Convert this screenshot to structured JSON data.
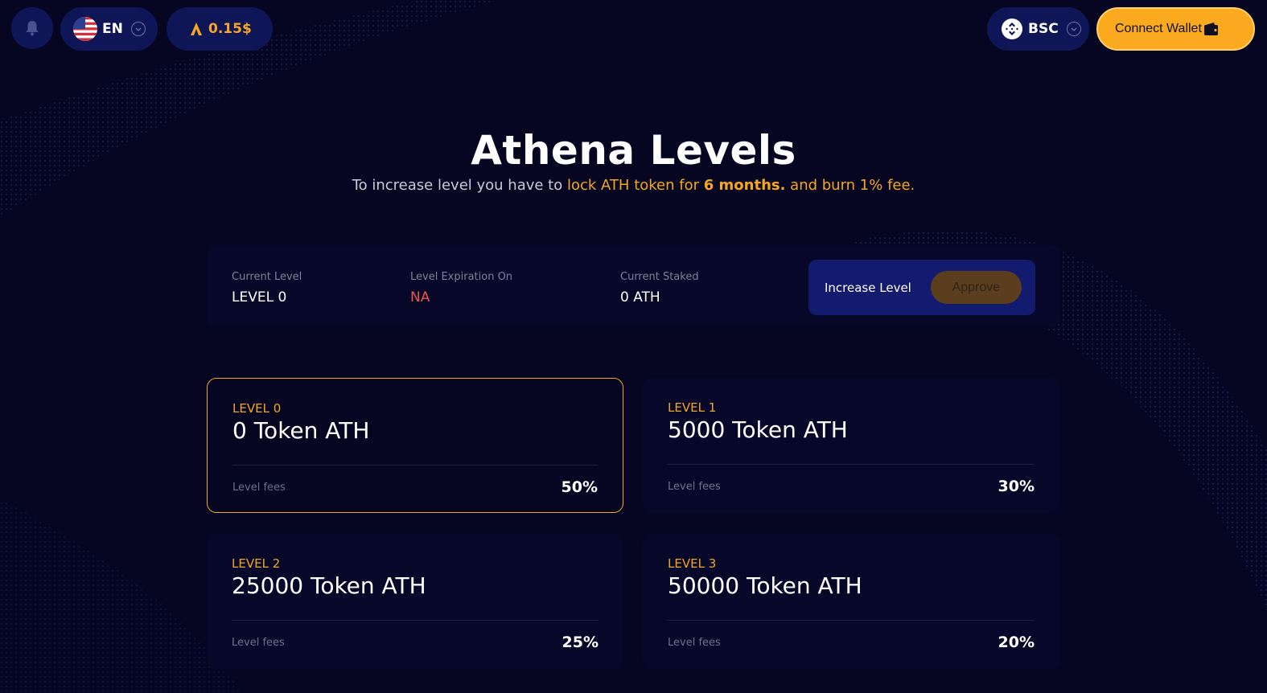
{
  "header": {
    "language": "EN",
    "token_price": "0.15$",
    "network": "BSC",
    "connect_wallet": "Connect Wallet"
  },
  "hero": {
    "title": "Athena Levels",
    "subtitle_prefix": "To increase level you have to ",
    "subtitle_highlight": "lock ATH token for ",
    "subtitle_bold": "6 months.",
    "subtitle_suffix": " and burn 1% fee."
  },
  "stats": {
    "current_level_label": "Current Level",
    "current_level_value": "LEVEL 0",
    "expiration_label": "Level Expiration On",
    "expiration_value": "NA",
    "staked_label": "Current Staked",
    "staked_value": "0 ATH",
    "increase_label": "Increase Level",
    "approve_label": "Approve"
  },
  "levels": [
    {
      "level": "LEVEL 0",
      "amount": "0 Token ATH",
      "fee_label": "Level fees",
      "fee": "50%",
      "active": true
    },
    {
      "level": "LEVEL 1",
      "amount": "5000 Token ATH",
      "fee_label": "Level fees",
      "fee": "30%",
      "active": false
    },
    {
      "level": "LEVEL 2",
      "amount": "25000 Token ATH",
      "fee_label": "Level fees",
      "fee": "25%",
      "active": false
    },
    {
      "level": "LEVEL 3",
      "amount": "50000 Token ATH",
      "fee_label": "Level fees",
      "fee": "20%",
      "active": false
    }
  ],
  "colors": {
    "background": "#060623",
    "accent": "#f5a623",
    "pill": "#0f1657",
    "danger": "#f0524f"
  }
}
